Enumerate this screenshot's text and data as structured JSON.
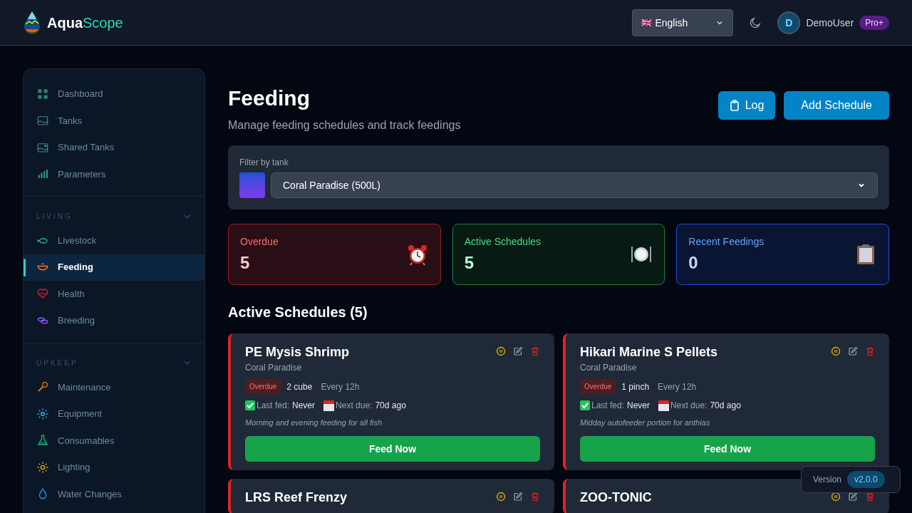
{
  "header": {
    "brand": {
      "part_1": "Aqua",
      "part_2": "Scope"
    },
    "language": {
      "flag": "🇬🇧",
      "value": "English"
    },
    "user": {
      "initial": "D",
      "name": "DemoUser",
      "plan": "Pro+"
    }
  },
  "sidebar": {
    "sections": [
      {
        "items": [
          {
            "label": "Dashboard",
            "selected": false
          },
          {
            "label": "Tanks",
            "selected": false
          },
          {
            "label": "Shared Tanks",
            "selected": false
          },
          {
            "label": "Parameters",
            "selected": false
          }
        ]
      },
      {
        "heading": "LIVING",
        "expanded": true,
        "items": [
          {
            "label": "Livestock",
            "selected": false
          },
          {
            "label": "Feeding",
            "selected": true
          },
          {
            "label": "Health",
            "selected": false
          },
          {
            "label": "Breeding",
            "selected": false
          }
        ]
      },
      {
        "heading": "UPKEEP",
        "expanded": true,
        "items": [
          {
            "label": "Maintenance",
            "selected": false
          },
          {
            "label": "Equipment",
            "selected": false
          },
          {
            "label": "Consumables",
            "selected": false
          },
          {
            "label": "Lighting",
            "selected": false
          },
          {
            "label": "Water Changes",
            "selected": false
          }
        ]
      }
    ]
  },
  "page": {
    "title": "Feeding",
    "subtitle": "Manage feeding schedules and track feedings",
    "buttons": [
      {
        "label": "Log",
        "kind": "log"
      },
      {
        "label": "Add Schedule",
        "kind": "add"
      }
    ]
  },
  "filter": {
    "label": "Filter by tank",
    "value": "Coral Paradise (500L)"
  },
  "stats": [
    {
      "label": "Overdue",
      "value": "5",
      "kind": "overdue"
    },
    {
      "label": "Active Schedules",
      "value": "5",
      "kind": "active"
    },
    {
      "label": "Recent Feedings",
      "value": "0",
      "kind": "recent"
    }
  ],
  "schedules": {
    "heading": "Active Schedules (5)",
    "cards": [
      {
        "name": "PE Mysis Shrimp",
        "tank": "Coral Paradise",
        "status": "Overdue",
        "overdue": true,
        "amount": "2 cube",
        "frequency": "Every 12h",
        "last_fed_label": "Last fed:",
        "last_fed": "Never",
        "next_due_label": "Next due:",
        "next_due": "70d ago",
        "notes": "Morning and evening feeding for all fish",
        "action": "Feed Now"
      },
      {
        "name": "Hikari Marine S Pellets",
        "tank": "Coral Paradise",
        "status": "Overdue",
        "overdue": true,
        "amount": "1 pinch",
        "frequency": "Every 12h",
        "last_fed_label": "Last fed:",
        "last_fed": "Never",
        "next_due_label": "Next due:",
        "next_due": "70d ago",
        "notes": "Midday autofeeder portion for anthias",
        "action": "Feed Now"
      },
      {
        "name": "LRS Reef Frenzy",
        "overdue": true
      },
      {
        "name": "ZOO-TONIC",
        "overdue": true
      }
    ]
  },
  "version": {
    "label": "Version",
    "value": "v2.0.0"
  }
}
